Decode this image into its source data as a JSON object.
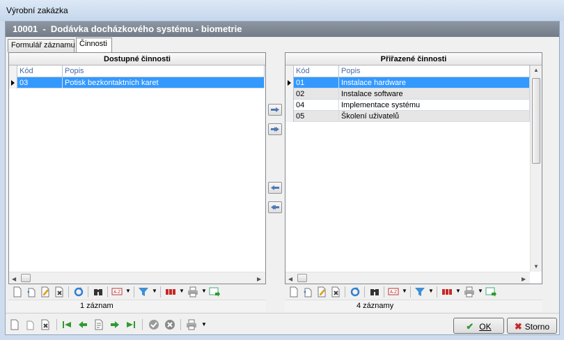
{
  "window": {
    "title": "Výrobní zakázka"
  },
  "header": {
    "title": "10001  -  Dodávka docházkového systému - biometrie"
  },
  "tabs": [
    {
      "label": "Formulář záznamu"
    },
    {
      "label": "Činnosti"
    }
  ],
  "available": {
    "caption": "Dostupné činnosti",
    "columns": [
      "Kód",
      "Popis"
    ],
    "rows": [
      {
        "code": "03",
        "desc": "Potisk bezkontaktních karet"
      }
    ],
    "status": "1 záznam"
  },
  "assigned": {
    "caption": "Přiřazené činnosti",
    "columns": [
      "Kód",
      "Popis"
    ],
    "rows": [
      {
        "code": "01",
        "desc": "Instalace hardware"
      },
      {
        "code": "02",
        "desc": "Instalace software"
      },
      {
        "code": "04",
        "desc": "Implementace systému"
      },
      {
        "code": "05",
        "desc": "Školení uživatelů"
      }
    ],
    "status": "4 záznamy"
  },
  "buttons": {
    "ok": "OK",
    "cancel": "Storno"
  },
  "colors": {
    "selection": "#3399ff",
    "header": "#7d8792",
    "accent_green": "#2f9a2f",
    "accent_red": "#c62828"
  }
}
